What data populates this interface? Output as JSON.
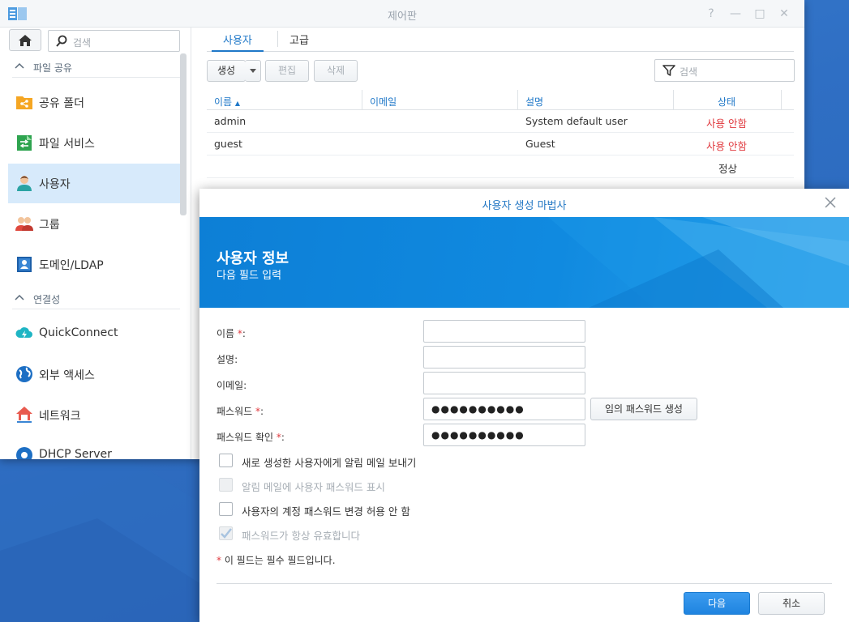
{
  "window": {
    "title": "제어판",
    "controls": [
      "?",
      "—",
      "□",
      "✕"
    ]
  },
  "sidebar": {
    "search_placeholder": "검색",
    "sections": [
      {
        "label": "파일 공유"
      },
      {
        "label": "연결성"
      }
    ],
    "items": [
      {
        "label": "공유 폴더",
        "icon": "shared-folder-icon"
      },
      {
        "label": "파일 서비스",
        "icon": "file-services-icon"
      },
      {
        "label": "사용자",
        "icon": "user-icon",
        "active": true
      },
      {
        "label": "그룹",
        "icon": "group-icon"
      },
      {
        "label": "도메인/LDAP",
        "icon": "domain-ldap-icon"
      },
      {
        "label": "QuickConnect",
        "icon": "quickconnect-icon"
      },
      {
        "label": "외부 액세스",
        "icon": "external-access-icon"
      },
      {
        "label": "네트워크",
        "icon": "network-icon"
      },
      {
        "label": "DHCP Server",
        "icon": "dhcp-server-icon"
      }
    ]
  },
  "main": {
    "tabs": [
      {
        "label": "사용자",
        "active": true
      },
      {
        "label": "고급"
      }
    ],
    "toolbar": {
      "create_label": "생성",
      "edit_label": "편집",
      "delete_label": "삭제",
      "search_placeholder": "검색"
    },
    "table": {
      "columns": [
        "이름",
        "이메일",
        "설명",
        "상태"
      ],
      "sort_indicator": "▲",
      "rows": [
        {
          "name": "admin",
          "email": "",
          "description": "System default user",
          "status": "사용 안함"
        },
        {
          "name": "guest",
          "email": "",
          "description": "Guest",
          "status": "사용 안함"
        },
        {
          "name": "",
          "email": "",
          "description": "",
          "status": "정상"
        }
      ]
    }
  },
  "wizard": {
    "title": "사용자 생성 마법사",
    "banner_title": "사용자 정보",
    "banner_subtitle": "다음 필드 입력",
    "fields": {
      "name_label": "이름",
      "description_label": "설명:",
      "email_label": "이메일:",
      "password_label": "패스워드",
      "confirm_label": "패스워드 확인",
      "required_mark": "*",
      "colon": ":",
      "password_value": "●●●●●●●●●●",
      "confirm_value": "●●●●●●●●●●"
    },
    "generate_password_label": "임의 패스워드 생성",
    "checkboxes": [
      {
        "label": "새로 생성한 사용자에게 알림 메일 보내기",
        "checked": false,
        "disabled": false
      },
      {
        "label": "알림 메일에 사용자 패스워드 표시",
        "checked": false,
        "disabled": true
      },
      {
        "label": "사용자의 계정 패스워드 변경 허용 안 함",
        "checked": false,
        "disabled": false
      },
      {
        "label": "패스워드가 항상 유효합니다",
        "checked": true,
        "disabled": true
      }
    ],
    "required_note_mark": "*",
    "required_note": " 이 필드는 필수 필드입니다.",
    "next_label": "다음",
    "cancel_label": "취소"
  },
  "colors": {
    "accent": "#1f78c8",
    "status_disabled": "#e0393e",
    "banner": "#108ae0",
    "desktop": "#2f6fc4"
  }
}
